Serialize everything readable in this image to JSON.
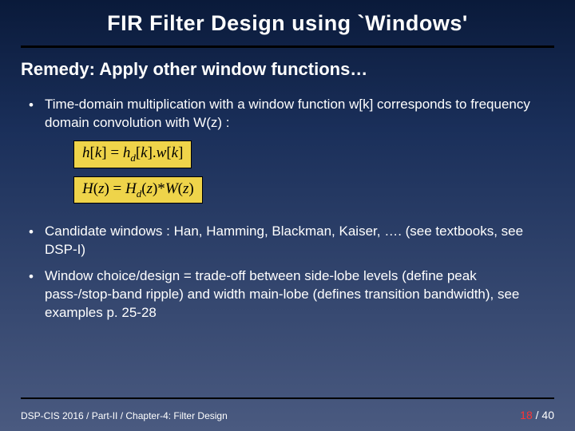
{
  "title": "FIR Filter Design using `Windows'",
  "remedy": "Remedy:  Apply other window functions…",
  "bullets": {
    "b1": "Time-domain multiplication with a window function w[k] corresponds to frequency domain convolution  with W(z) :",
    "b2": "Candidate windows : Han, Hamming, Blackman, Kaiser, …. (see textbooks, see DSP-I)",
    "b3": "Window choice/design = trade-off between side-lobe levels (define peak pass-/stop-band ripple) and width main-lobe (defines transition bandwidth), see examples p. 25-28"
  },
  "equations": {
    "eq1_plain": "h[k] = h_d[k].w[k]",
    "eq2_plain": "H(z) = H_d(z)*W(z)"
  },
  "footer": {
    "left": "DSP-CIS 2016  /  Part-II  /  Chapter-4: Filter Design",
    "page_current": "18",
    "page_sep": " / ",
    "page_total": "40"
  }
}
